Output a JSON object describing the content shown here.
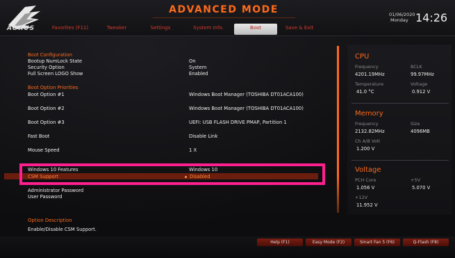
{
  "header": {
    "title": "ADVANCED MODE",
    "logo_text": "AORUS",
    "date_line1": "01/06/2020",
    "date_line2": "Monday",
    "time": "14:26",
    "tabs": [
      {
        "label": "Favorites (F11)"
      },
      {
        "label": "Tweaker"
      },
      {
        "label": "Settings"
      },
      {
        "label": "System Info."
      },
      {
        "label": "Boot"
      },
      {
        "label": "Save & Exit"
      }
    ],
    "active_tab": "Boot"
  },
  "boot_configuration": {
    "heading": "Boot Configuration",
    "items": [
      {
        "label": "Bootup NumLock State",
        "value": "On"
      },
      {
        "label": "Security Option",
        "value": "System"
      },
      {
        "label": "Full Screen LOGO Show",
        "value": "Enabled"
      }
    ]
  },
  "boot_option_priorities": {
    "heading": "Boot Option Priorities",
    "items": [
      {
        "label": "Boot Option #1",
        "value": "Windows Boot Manager (TOSHIBA DT01ACA100)"
      },
      {
        "label": "Boot Option #2",
        "value": "Windows Boot Manager (TOSHIBA DT01ACA100)"
      },
      {
        "label": "Boot Option #3",
        "value": "UEFI: USB FLASH DRIVE PMAP, Partition 1"
      },
      {
        "label": "Fast Boot",
        "value": "Disable Link"
      },
      {
        "label": "Mouse Speed",
        "value": "1 X"
      }
    ]
  },
  "windows_features": {
    "label": "Windows 10 Features",
    "value": "Windows 10"
  },
  "csm_support": {
    "label": "CSM Support",
    "value": "Disabled"
  },
  "passwords": [
    {
      "label": "Administrator Password"
    },
    {
      "label": "User Password"
    }
  ],
  "option_description": {
    "heading": "Option Description",
    "text": "Enable/Disable CSM Support."
  },
  "right_panel": {
    "cpu": {
      "title": "CPU",
      "frequency_label": "Frequency",
      "frequency_value": "4201.19MHz",
      "bclk_label": "BCLK",
      "bclk_value": "99.97MHz",
      "temperature_label": "Temperature",
      "temperature_value": "41.0 °C",
      "voltage_label": "Voltage",
      "voltage_value": "0.912 V"
    },
    "memory": {
      "title": "Memory",
      "frequency_label": "Frequency",
      "frequency_value": "2132.82MHz",
      "size_label": "Size",
      "size_value": "4096MB",
      "volt_label": "Ch A/B Volt",
      "volt_value": "1.200 V"
    },
    "voltage": {
      "title": "Voltage",
      "pch_label": "PCH Core",
      "pch_value": "1.056 V",
      "p5_label": "+5V",
      "p5_value": "5.070 V",
      "p12_label": "+12V",
      "p12_value": "11.952 V"
    }
  },
  "footer_buttons": [
    {
      "label": "Help (F1)"
    },
    {
      "label": "Easy Mode (F2)"
    },
    {
      "label": "Smart Fan 5 (F6)"
    },
    {
      "label": "Q-Flash (F8)"
    }
  ],
  "colors": {
    "accent": "#ff6a1a",
    "tab_text": "#d23b2b",
    "highlight": "#6b1d0e",
    "callout": "#ff1f8e"
  }
}
